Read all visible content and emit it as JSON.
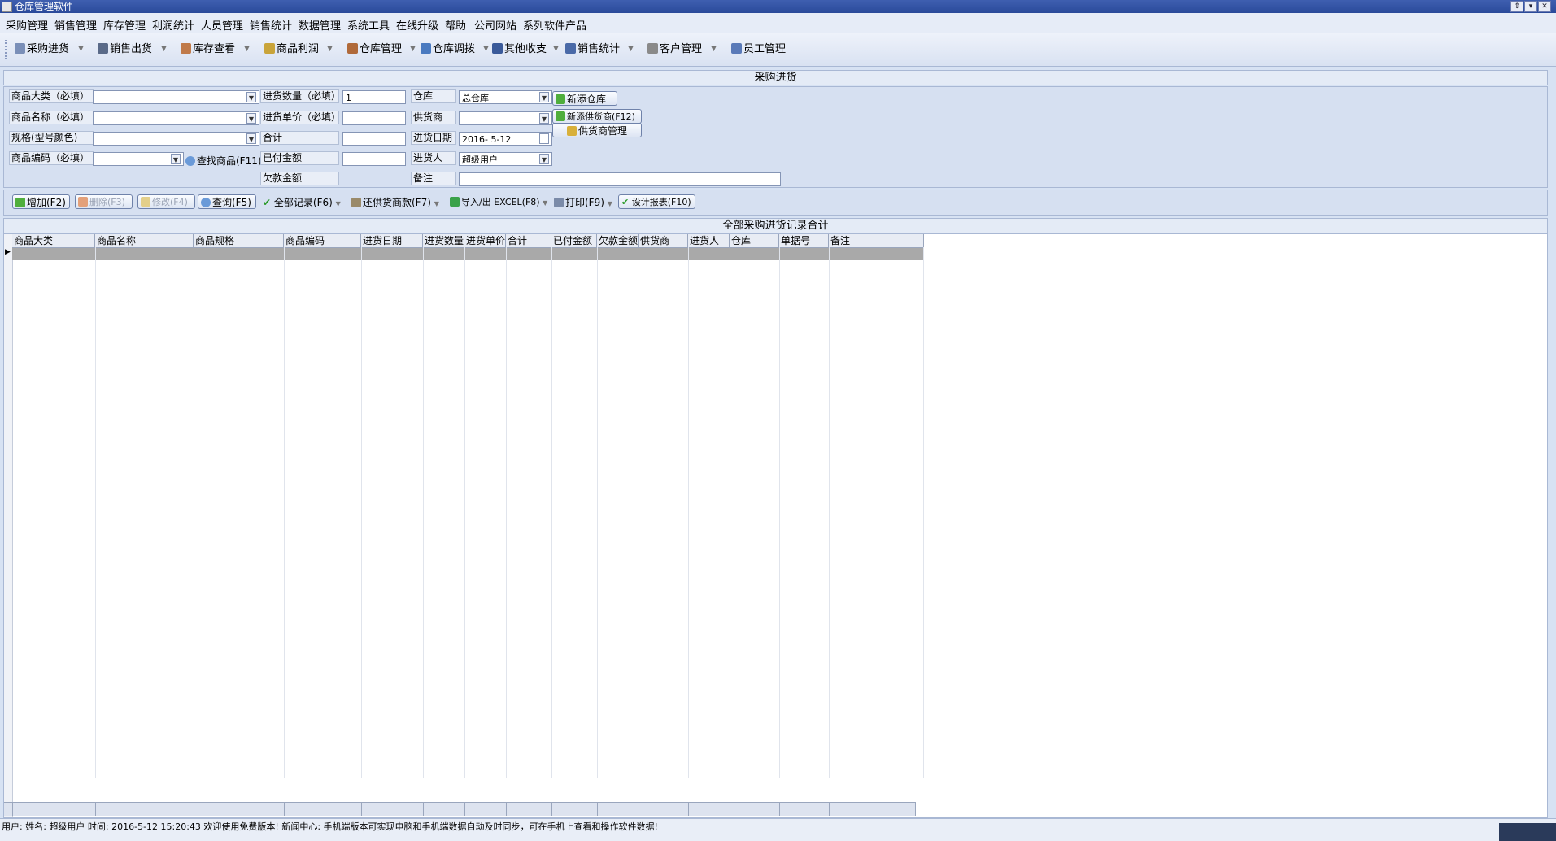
{
  "window": {
    "title": "仓库管理软件"
  },
  "menu": [
    "采购管理",
    "销售管理",
    "库存管理",
    "利润统计",
    "人员管理",
    "销售统计",
    "数据管理",
    "系统工具",
    "在线升级",
    "帮助",
    "公司网站",
    "系列软件产品"
  ],
  "toolbar": [
    "采购进货",
    "销售出货",
    "库存查看",
    "商品利润",
    "仓库管理",
    "仓库调拨",
    "其他收支",
    "销售统计",
    "客户管理",
    "员工管理"
  ],
  "section_title": "采购进货",
  "form": {
    "labels": {
      "category": "商品大类（必填）",
      "name": "商品名称（必填）",
      "spec": "规格(型号颜色)",
      "code": "商品编码（必填）",
      "qty": "进货数量（必填）",
      "price": "进货单价（必填）",
      "total": "合计",
      "paid": "已付金额",
      "owed": "欠款金额",
      "warehouse": "仓库",
      "supplier": "供货商",
      "date": "进货日期",
      "person": "进货人",
      "remark": "备注"
    },
    "values": {
      "qty": "1",
      "warehouse": "总仓库",
      "date": "2016- 5-12",
      "person": "超级用户"
    },
    "buttons": {
      "find_product": "查找商品(F11)",
      "new_warehouse": "新添仓库",
      "new_supplier": "新添供货商(F12)",
      "supplier_mgmt": "供货商管理"
    }
  },
  "actions": {
    "add": "增加(F2)",
    "delete": "删除(F3)",
    "modify": "修改(F4)",
    "query": "查询(F5)",
    "all_records": "全部记录(F6)",
    "pay_supplier": "还供货商款(F7)",
    "import_export": "导入/出 EXCEL(F8)",
    "print": "打印(F9)",
    "design_report": "设计报表(F10)"
  },
  "records_title": "全部采购进货记录合计",
  "table": {
    "columns": [
      "商品大类",
      "商品名称",
      "商品规格",
      "商品编码",
      "进货日期",
      "进货数量",
      "进货单价",
      "合计",
      "已付金额",
      "欠款金额",
      "供货商",
      "进货人",
      "仓库",
      "单据号",
      "备注"
    ]
  },
  "status": {
    "text": "用户:   姓名: 超级用户  时间: 2016-5-12 15:20:43 欢迎使用免费版本!    新闻中心: 手机端版本可实现电脑和手机端数据自动及时同步，可在手机上查看和操作软件数据!"
  },
  "colors": {
    "titlebar": "#2a4a9a",
    "panel": "#d6e0f1",
    "selected_row": "#a9a9a9"
  }
}
